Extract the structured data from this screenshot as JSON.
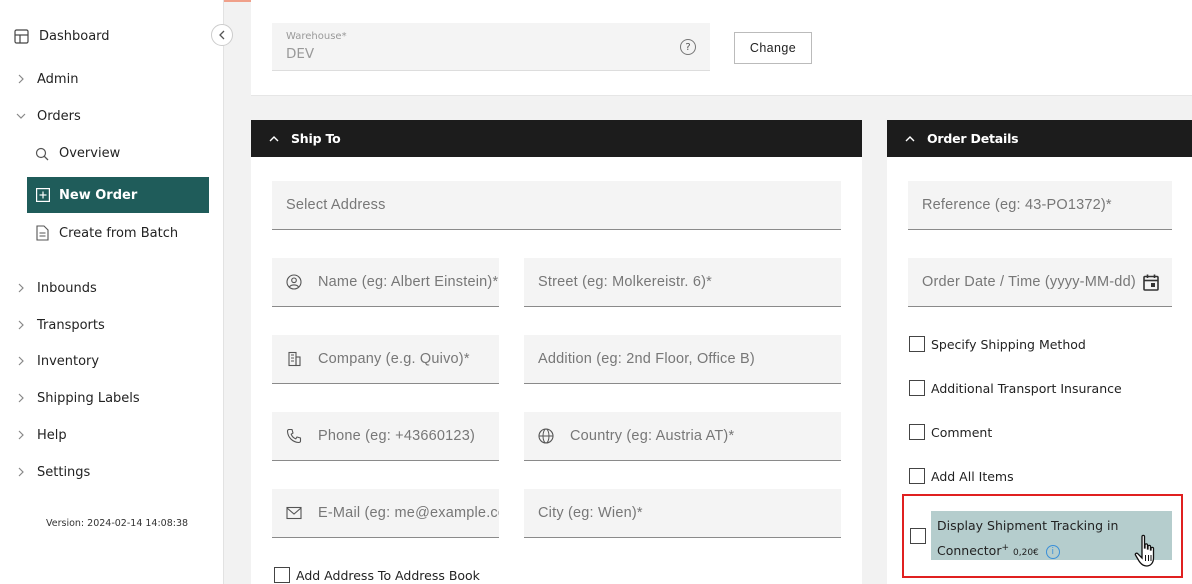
{
  "sidebar": {
    "dashboard": "Dashboard",
    "items": [
      {
        "label": "Admin",
        "expanded": false
      },
      {
        "label": "Orders",
        "expanded": true
      },
      {
        "label": "Inbounds",
        "expanded": false
      },
      {
        "label": "Transports",
        "expanded": false
      },
      {
        "label": "Inventory",
        "expanded": false
      },
      {
        "label": "Shipping Labels",
        "expanded": false
      },
      {
        "label": "Help",
        "expanded": false
      },
      {
        "label": "Settings",
        "expanded": false
      }
    ],
    "orders_sub": {
      "overview": "Overview",
      "new_order": "New Order",
      "create_from_batch": "Create from Batch"
    },
    "version": "Version: 2024-02-14 14:08:38"
  },
  "warehouse": {
    "label": "Warehouse*",
    "value": "DEV",
    "help_icon": "?",
    "change_button": "Change"
  },
  "ship_to": {
    "title": "Ship To",
    "select_address": "Select Address",
    "name_placeholder": "Name (eg: Albert Einstein)*",
    "street_placeholder": "Street (eg: Molkereistr. 6)*",
    "company_placeholder": "Company (e.g. Quivo)*",
    "addition_placeholder": "Addition (eg: 2nd Floor, Office B)",
    "phone_placeholder": "Phone (eg: +43660123)",
    "country_placeholder": "Country (eg: Austria AT)*",
    "email_placeholder": "E-Mail (eg: me@example.com)",
    "city_placeholder": "City (eg: Wien)*",
    "add_to_book": "Add Address To Address Book"
  },
  "order_details": {
    "title": "Order Details",
    "reference_placeholder": "Reference (eg: 43-PO1372)*",
    "date_placeholder": "Order Date / Time (yyyy-MM-dd)",
    "checkboxes": {
      "shipping_method": "Specify Shipping Method",
      "insurance": "Additional Transport Insurance",
      "comment": "Comment",
      "add_all_items": "Add All Items",
      "tracking_line1": "Display Shipment Tracking in",
      "tracking_line2": "Connector",
      "tracking_marker": "+",
      "tracking_price": "0,20€"
    },
    "info_icon": "i"
  },
  "colors": {
    "accent": "#1f5c5a",
    "header_bg": "#1c1c1c",
    "highlight_border": "#e02020",
    "tracking_bg": "#b5cdcd"
  }
}
